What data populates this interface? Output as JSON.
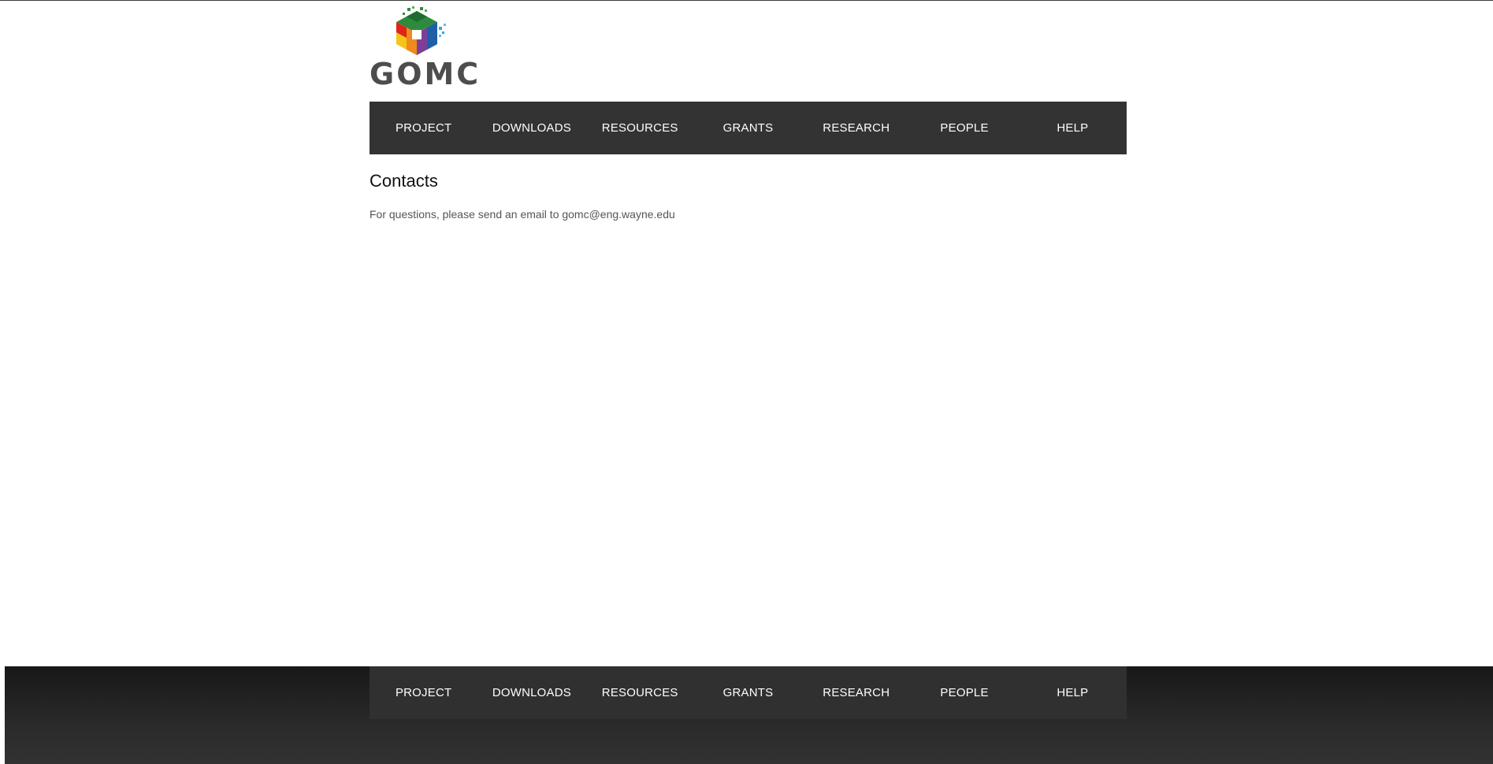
{
  "brand": {
    "name": "GOMC",
    "colors": {
      "green": "#2e8b3e",
      "yellow": "#f5c518",
      "orange": "#f08a1c",
      "red": "#e2231a",
      "purple": "#7b3f98",
      "blue": "#1f5fa8",
      "cyan": "#2aa7d8"
    }
  },
  "nav": {
    "items": [
      {
        "label": "PROJECT"
      },
      {
        "label": "DOWNLOADS"
      },
      {
        "label": "RESOURCES"
      },
      {
        "label": "GRANTS"
      },
      {
        "label": "RESEARCH"
      },
      {
        "label": "PEOPLE"
      },
      {
        "label": "HELP"
      }
    ]
  },
  "main": {
    "title": "Contacts",
    "text": "For questions, please send an email to gomc@eng.wayne.edu"
  },
  "footer": {
    "nav": {
      "items": [
        {
          "label": "PROJECT"
        },
        {
          "label": "DOWNLOADS"
        },
        {
          "label": "RESOURCES"
        },
        {
          "label": "GRANTS"
        },
        {
          "label": "RESEARCH"
        },
        {
          "label": "PEOPLE"
        },
        {
          "label": "HELP"
        }
      ]
    }
  }
}
